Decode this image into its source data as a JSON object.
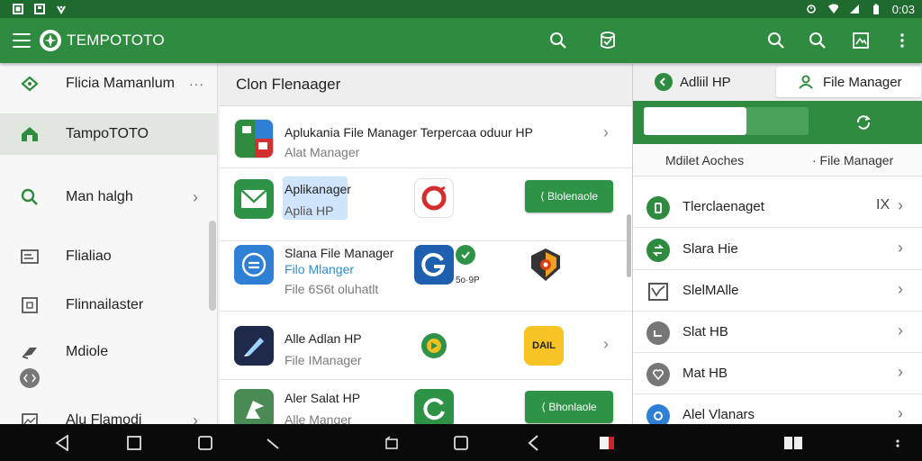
{
  "status": {
    "time": "0:03"
  },
  "appbar": {
    "title": "TEMPOTOTO"
  },
  "drawer": {
    "items": [
      {
        "label": "Flicia Mamanlum",
        "icon": "location-icon"
      },
      {
        "label": "TampoTOTO",
        "icon": "home-icon"
      },
      {
        "label": "Man halgh",
        "icon": "search-icon"
      },
      {
        "label": "Flialiao",
        "icon": "list-icon"
      },
      {
        "label": "Flinnailaster",
        "icon": "box-icon"
      },
      {
        "label": "Mdiole",
        "icon": "share-icon"
      },
      {
        "label": "Alu Flamodi",
        "icon": "image-icon"
      }
    ],
    "item0_dots": "···"
  },
  "middle": {
    "header": "Clon Flenaager",
    "rows": [
      {
        "title": "Aplukania File Manager Terpercaa oduur HP",
        "subtitle": "Alat Manager"
      },
      {
        "title": "Aplikanager",
        "subtitle": "Aplia HP",
        "button": "⟨ Blolenaole"
      },
      {
        "title": "Slana File Manager",
        "subtitle": "Filo Mlanger",
        "subtitle2": "File 6S6t oluhatlt",
        "badge": "5o·9P"
      },
      {
        "title": "Alle Adlan HP",
        "subtitle": "File IManager",
        "badge": "DAIL"
      },
      {
        "title": "Aler Salat HP",
        "subtitle": "Alle Manger",
        "button": "⟨ Bhonlaole"
      }
    ]
  },
  "right": {
    "tabs": [
      {
        "label": "Adliil HP"
      },
      {
        "label": "File Manager"
      }
    ],
    "subhead_left": "Mdilet Aoches",
    "subhead_right": "· File Manager",
    "rows": [
      {
        "label": "Tlerclaenaget",
        "extra": "IX",
        "color": "#2e8b3f"
      },
      {
        "label": "Slara Hie",
        "color": "#2e8b3f"
      },
      {
        "label": "SlelMAlle",
        "color": "#777777"
      },
      {
        "label": "Slat HB",
        "color": "#777777"
      },
      {
        "label": "Mat HB",
        "color": "#777777"
      },
      {
        "label": "Alel Vlanars",
        "color": "#2f7fd4"
      }
    ]
  },
  "colors": {
    "primary": "#2e8b3f",
    "status_bar": "#1f6b2f",
    "nav_bar": "#0a0a0a",
    "accent_blue": "#2f8fd4"
  }
}
